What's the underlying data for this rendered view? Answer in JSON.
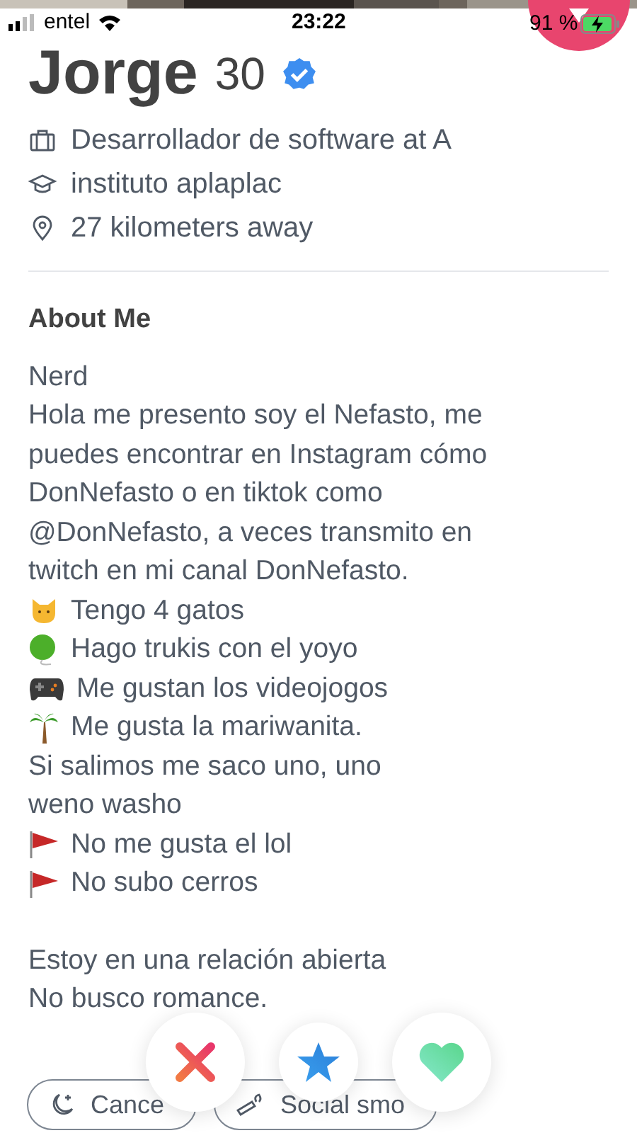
{
  "status_bar": {
    "carrier": "entel",
    "time": "23:22",
    "battery": "91 %"
  },
  "profile": {
    "name": "Jorge",
    "age": "30",
    "verified": true,
    "details": [
      {
        "kind": "job",
        "text": "Desarrollador de software at A"
      },
      {
        "kind": "school",
        "text": "instituto aplaplac"
      },
      {
        "kind": "distance",
        "text": "27 kilometers away"
      }
    ]
  },
  "about": {
    "heading": "About Me",
    "paragraphs": [
      {
        "lines": [
          {
            "kind": "text",
            "text": "Nerd"
          },
          {
            "kind": "text",
            "text": "Hola me presento soy el Nefasto, me"
          },
          {
            "kind": "text",
            "text": "puedes encontrar en Instagram cómo"
          },
          {
            "kind": "text",
            "text": "DonNefasto o en tiktok como"
          },
          {
            "kind": "text",
            "text": "@DonNefasto, a veces transmito en"
          },
          {
            "kind": "text",
            "text": "twitch en mi canal DonNefasto."
          },
          {
            "kind": "cat",
            "text": "Tengo 4 gatos"
          },
          {
            "kind": "yoyo",
            "text": "Hago trukis con el yoyo"
          },
          {
            "kind": "gamepad",
            "text": "Me gustan los videojogos"
          },
          {
            "kind": "palm",
            "text": "Me gusta la mariwanita."
          },
          {
            "kind": "text",
            "text": "Si salimos me saco uno, uno"
          },
          {
            "kind": "text",
            "text": "weno washo"
          },
          {
            "kind": "flag",
            "text": "No me gusta el lol"
          },
          {
            "kind": "flag",
            "text": "No subo cerros"
          }
        ]
      },
      {
        "lines": [
          {
            "kind": "text",
            "text": "Estoy en una relación abierta"
          },
          {
            "kind": "text",
            "text": "No busco romance."
          }
        ]
      }
    ]
  },
  "tags": [
    {
      "kind": "zodiac",
      "text": "Cance"
    },
    {
      "kind": "smoking",
      "text": "Social smo"
    }
  ],
  "actions": [
    {
      "kind": "nope"
    },
    {
      "kind": "super_like"
    },
    {
      "kind": "like"
    }
  ]
}
